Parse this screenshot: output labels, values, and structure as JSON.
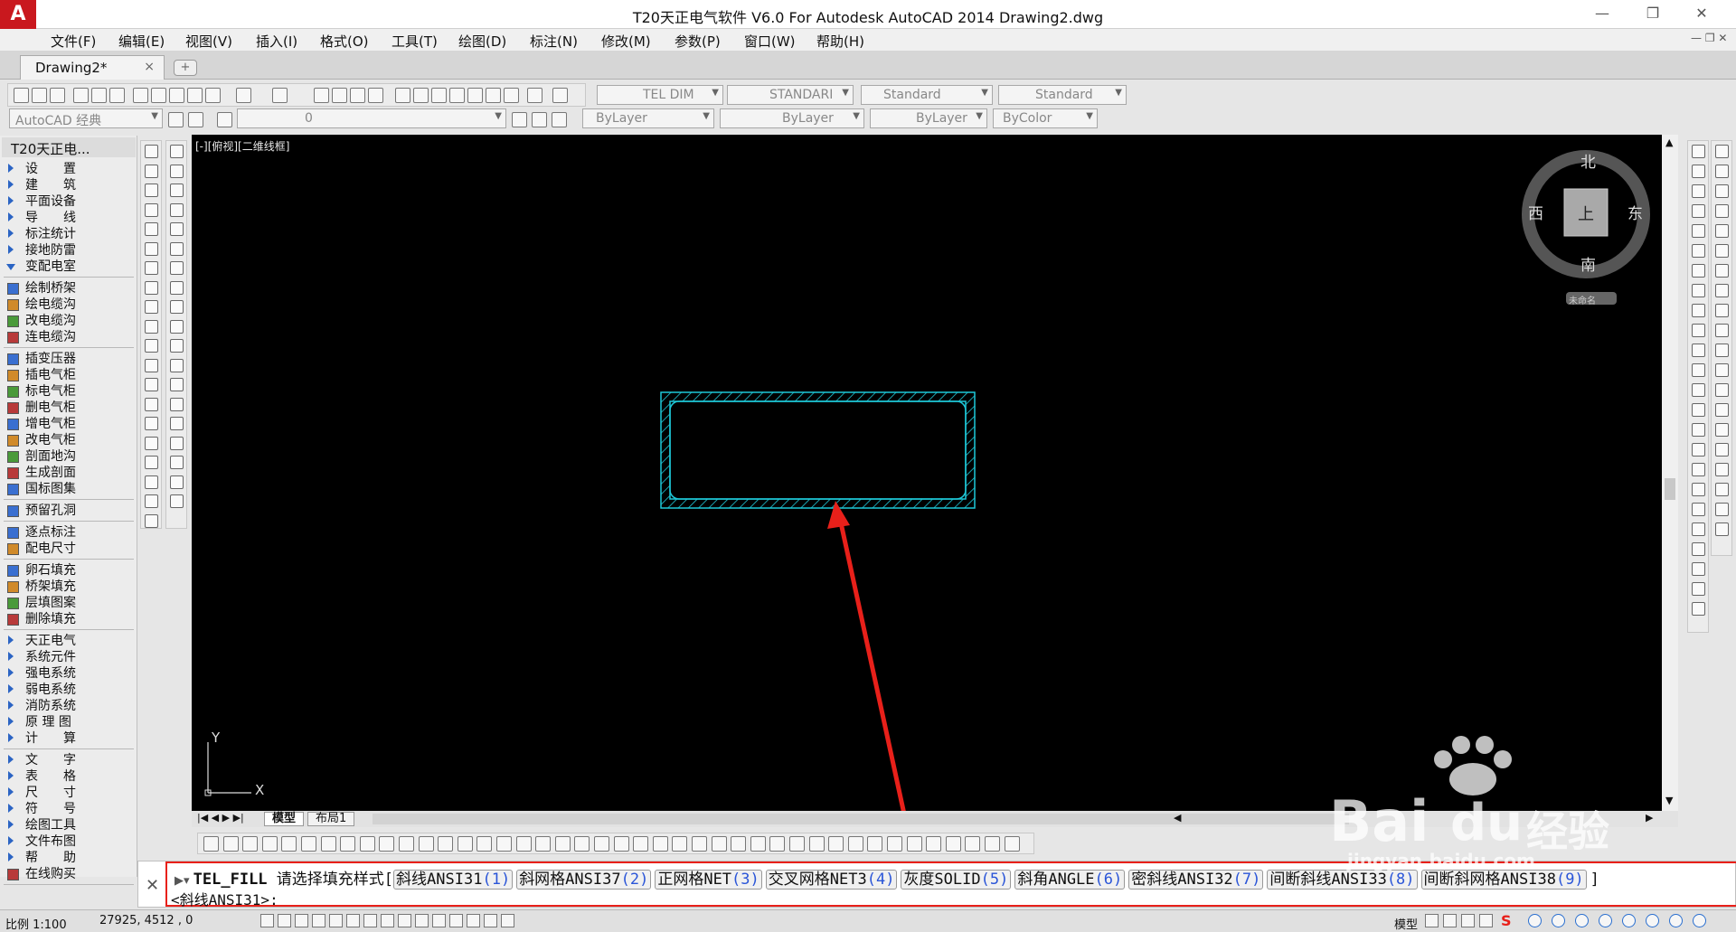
{
  "window": {
    "logo": "A",
    "title": "T20天正电气软件 V6.0 For Autodesk AutoCAD 2014    Drawing2.dwg"
  },
  "menu": [
    "文件(F)",
    "编辑(E)",
    "视图(V)",
    "插入(I)",
    "格式(O)",
    "工具(T)",
    "绘图(D)",
    "标注(N)",
    "修改(M)",
    "参数(P)",
    "窗口(W)",
    "帮助(H)"
  ],
  "drawing_tab": {
    "label": "Drawing2*",
    "close": "×",
    "new": "+"
  },
  "toolbar": {
    "dim_style": "TEL DIM",
    "table_style": "STANDARI",
    "text_style": "Standard",
    "mleader_style": "Standard",
    "workspace": "AutoCAD 经典",
    "layer": "0",
    "color": "ByLayer",
    "linetype": "ByLayer",
    "lineweight": "ByLayer",
    "plotstyle": "ByColor"
  },
  "panel": {
    "title": "T20天正电...",
    "groups": [
      [
        "设　　置",
        "建　　筑",
        "平面设备",
        "导　　线",
        "标注统计",
        "接地防雷",
        "变配电室"
      ],
      [
        "绘制桥架",
        "绘电缆沟",
        "改电缆沟",
        "连电缆沟"
      ],
      [
        "插变压器",
        "插电气柜",
        "标电气柜",
        "删电气柜",
        "增电气柜",
        "改电气柜",
        "剖面地沟",
        "生成剖面",
        "国标图集"
      ],
      [
        "预留孔洞"
      ],
      [
        "逐点标注",
        "配电尺寸"
      ],
      [
        "卵石填充",
        "桥架填充",
        "层填图案",
        "删除填充"
      ],
      [
        "天正电气",
        "系统元件",
        "强电系统",
        "弱电系统",
        "消防系统",
        "原 理 图",
        "计　　算"
      ],
      [
        "文　　字",
        "表　　格",
        "尺　　寸",
        "符　　号",
        "绘图工具",
        "文件布图",
        "帮　　助",
        "在线购买"
      ]
    ]
  },
  "viewport": {
    "label": "[-][俯视][二维线框]",
    "viewcube": {
      "north": "北",
      "south": "南",
      "east": "东",
      "west": "西",
      "top": "上",
      "wcs": "未命名"
    },
    "ucs": {
      "y": "Y",
      "x": "X"
    }
  },
  "layout_tabs": [
    "模型",
    "布局1"
  ],
  "command": {
    "name": "TEL_FILL",
    "prompt": "请选择填充样式[",
    "options": [
      {
        "label": "斜线ANSI31",
        "key": "(1)"
      },
      {
        "label": "斜网格ANSI37",
        "key": "(2)"
      },
      {
        "label": "正网格NET",
        "key": "(3)"
      },
      {
        "label": "交叉网格NET3",
        "key": "(4)"
      },
      {
        "label": "灰度SOLID",
        "key": "(5)"
      },
      {
        "label": "斜角ANGLE",
        "key": "(6)"
      },
      {
        "label": "密斜线ANSI32",
        "key": "(7)"
      },
      {
        "label": "间断斜线ANSI33",
        "key": "(8)"
      },
      {
        "label": "间断斜网格ANSI38",
        "key": "(9)"
      }
    ],
    "close_bracket": "]",
    "default_line": "<斜线ANSI31>:"
  },
  "status": {
    "scale": "比例 1:100",
    "coords": "27925, 4512 , 0",
    "model": "模型"
  },
  "watermark": {
    "brand": "Bai",
    "du": "du",
    "jingyan": "经验",
    "url": "jingyan.baidu.com"
  },
  "colors": {
    "accent_red": "#e8201a",
    "cad_cyan": "#1ec8d8",
    "canvas": "#000000",
    "option_blue": "#2a55d8"
  }
}
